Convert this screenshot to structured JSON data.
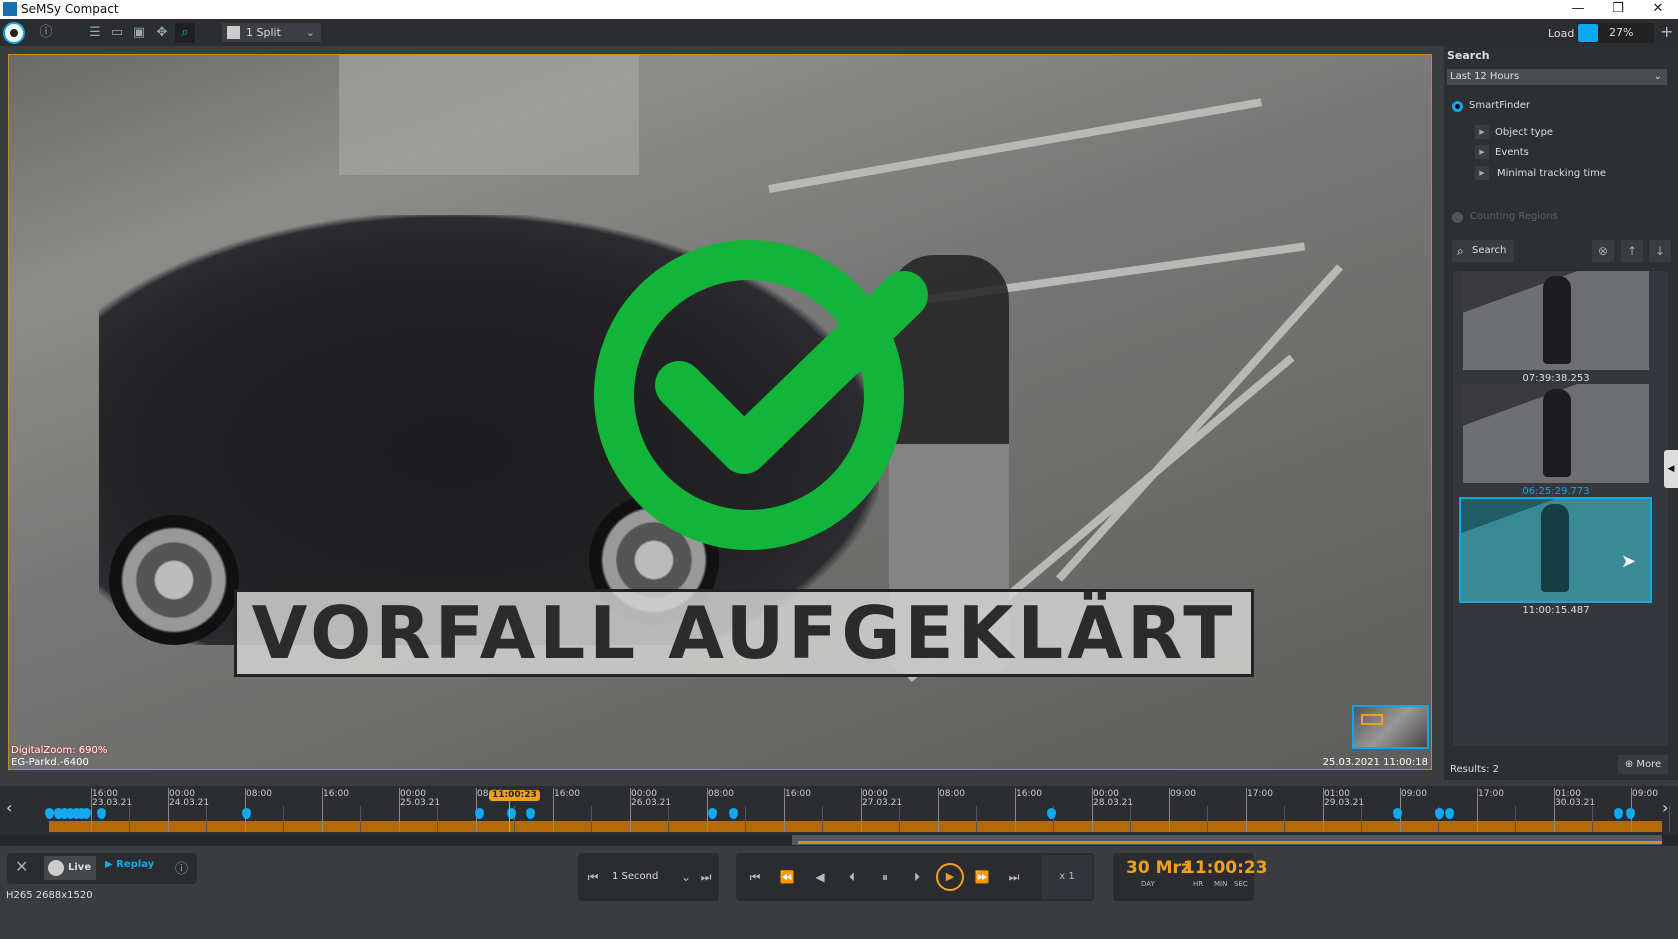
{
  "window": {
    "title": "SeMSy Compact",
    "minimize": "—",
    "maximize": "❐",
    "close": "✕"
  },
  "toolbar": {
    "split_label": "1 Split",
    "load_label": "Load",
    "load_percent": 27,
    "load_text": "27%",
    "add": "+"
  },
  "video": {
    "overlay_text": "VORFALL AUFGEKLÄRT",
    "digital_zoom": "DigitalZoom: 690%",
    "camera": "EG-Parkd.-6400",
    "timestamp": "25.03.2021 11:00:18",
    "check_color": "#12b53a",
    "border_color": "#c8892a"
  },
  "search_panel": {
    "title": "Search",
    "range": "Last 12 Hours",
    "smartfinder": "SmartFinder",
    "filters": [
      "Object type",
      "Events",
      "Minimal tracking time"
    ],
    "counting_regions": "Counting Regions",
    "search_button": "Search",
    "results": [
      {
        "time": "07:39:38.253"
      },
      {
        "time": "06:25:29.773"
      },
      {
        "time": "11:00:15.487",
        "selected": true
      }
    ],
    "results_count": "Results:  2",
    "more_button": "More"
  },
  "timeline": {
    "current": "11:00:23",
    "labels": [
      [
        "16:00",
        "23.03.21"
      ],
      [
        "00:00",
        "24.03.21"
      ],
      [
        "08:00",
        ""
      ],
      [
        "16:00",
        ""
      ],
      [
        "00:00",
        "25.03.21"
      ],
      [
        "08:00",
        ""
      ],
      [
        "16:00",
        ""
      ],
      [
        "00:00",
        "26.03.21"
      ],
      [
        "08:00",
        ""
      ],
      [
        "16:00",
        ""
      ],
      [
        "00:00",
        "27.03.21"
      ],
      [
        "08:00",
        ""
      ],
      [
        "16:00",
        ""
      ],
      [
        "00:00",
        "28.03.21"
      ],
      [
        "09:00",
        ""
      ],
      [
        "17:00",
        ""
      ],
      [
        "01:00",
        "29.03.21"
      ],
      [
        "09:00",
        ""
      ],
      [
        "17:00",
        ""
      ],
      [
        "01:00",
        "30.03.21"
      ],
      [
        "09:00",
        ""
      ]
    ],
    "accent": "#b56a0a",
    "marker_color": "#12a9ee"
  },
  "controls": {
    "live": "Live",
    "replay": "Replay",
    "codec": "H265  2688x1520",
    "step": "1 Second",
    "speed": "x 1",
    "day": "30 Mrz",
    "time": "11:00:23",
    "day_label": "DAY",
    "hr": "HR",
    "min": "MIN",
    "sec": "SEC"
  }
}
